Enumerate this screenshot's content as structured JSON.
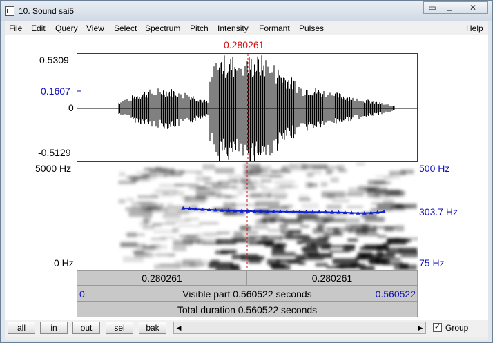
{
  "window": {
    "title": "10. Sound sai5"
  },
  "window_controls": {
    "minimize": "▭",
    "maximize": "◻",
    "close": "✕"
  },
  "menu": [
    "File",
    "Edit",
    "Query",
    "View",
    "Select",
    "Spectrum",
    "Pitch",
    "Intensity",
    "Formant",
    "Pulses",
    "Help"
  ],
  "cursor": {
    "time_label": "0.280261"
  },
  "waveform": {
    "max_label": "0.5309",
    "cursor_value_label": "0.1607",
    "zero_label": "0",
    "min_label": "-0.5129"
  },
  "spectrogram": {
    "top_freq_label": "5000 Hz",
    "bottom_freq_label": "0 Hz"
  },
  "pitch": {
    "top_label": "500 Hz",
    "value_label": "303.7 Hz",
    "bottom_label": "75 Hz",
    "track_hz": [
      318,
      316,
      314,
      313,
      312,
      311,
      310,
      309,
      308,
      307,
      307,
      306,
      306,
      305,
      305,
      305,
      304,
      304,
      304,
      303,
      303,
      303,
      303,
      302,
      302,
      301,
      300,
      299,
      299,
      300,
      302,
      304
    ],
    "track_start_s": 0.175,
    "track_end_s": 0.505
  },
  "time_bars": {
    "left_segment": "0.280261",
    "right_segment": "0.280261",
    "visible_start": "0",
    "visible_part": "Visible part 0.560522 seconds",
    "visible_end": "0.560522",
    "total_duration": "Total duration 0.560522 seconds"
  },
  "buttons": {
    "all": "all",
    "in": "in",
    "out": "out",
    "sel": "sel",
    "bak": "bak"
  },
  "group": {
    "label": "Group",
    "checked": "✓"
  },
  "colors": {
    "axis_blue": "#1010c0",
    "cursor_red": "#d81010",
    "pitch_track": "#1020d0"
  }
}
